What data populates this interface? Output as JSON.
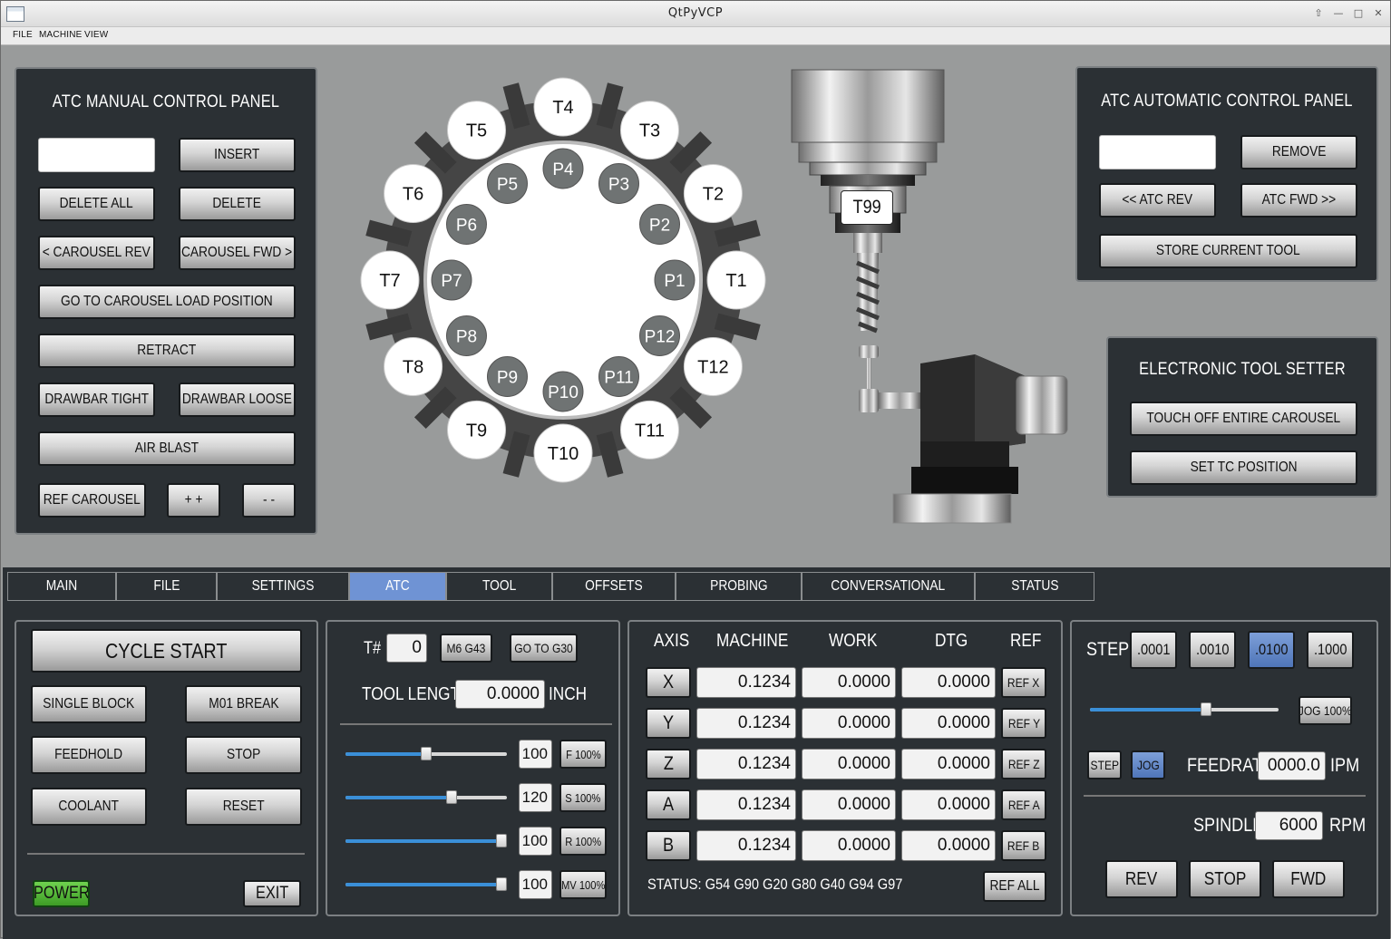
{
  "window": {
    "title": "QtPyVCP"
  },
  "menu": [
    "FILE",
    "MACHINE",
    "VIEW"
  ],
  "atc_manual": {
    "title": "ATC MANUAL CONTROL PANEL",
    "tool_input": "",
    "insert": "INSERT",
    "delete_all": "DELETE ALL",
    "delete": "DELETE",
    "carousel_rev": "< CAROUSEL REV",
    "carousel_fwd": "CAROUSEL FWD >",
    "load_position": "GO TO CAROUSEL LOAD POSITION",
    "retract": "RETRACT",
    "drawbar_tight": "DRAWBAR TIGHT",
    "drawbar_loose": "DRAWBAR LOOSE",
    "air_blast": "AIR BLAST",
    "ref_carousel": "REF CAROUSEL",
    "plus": "+ +",
    "minus": "- -"
  },
  "carousel": {
    "tools": [
      "T1",
      "T2",
      "T3",
      "T4",
      "T5",
      "T6",
      "T7",
      "T8",
      "T9",
      "T10",
      "T11",
      "T12"
    ],
    "pockets": [
      "P1",
      "P2",
      "P3",
      "P4",
      "P5",
      "P6",
      "P7",
      "P8",
      "P9",
      "P10",
      "P11",
      "P12"
    ]
  },
  "spindle_tool": "T99",
  "atc_auto": {
    "title": "ATC AUTOMATIC CONTROL PANEL",
    "tool_input": "",
    "remove": "REMOVE",
    "atc_rev": "<< ATC REV",
    "atc_fwd": "ATC FWD >>",
    "store": "STORE CURRENT TOOL"
  },
  "tool_setter": {
    "title": "ELECTRONIC TOOL SETTER",
    "touch_off": "TOUCH OFF ENTIRE CAROUSEL",
    "set_tc": "SET TC POSITION"
  },
  "tabs": [
    {
      "label": "MAIN"
    },
    {
      "label": "FILE"
    },
    {
      "label": "SETTINGS"
    },
    {
      "label": "ATC",
      "active": true
    },
    {
      "label": "TOOL"
    },
    {
      "label": "OFFSETS"
    },
    {
      "label": "PROBING"
    },
    {
      "label": "CONVERSATIONAL"
    },
    {
      "label": "STATUS"
    }
  ],
  "control": {
    "cycle_start": "CYCLE START",
    "single_block": "SINGLE BLOCK",
    "m01_break": "M01 BREAK",
    "feedhold": "FEEDHOLD",
    "stop": "STOP",
    "coolant": "COOLANT",
    "reset": "RESET",
    "power": "POWER",
    "exit": "EXIT"
  },
  "tool_panel": {
    "t_label": "T#",
    "t_value": "0",
    "m6_g43": "M6 G43",
    "go_to_g30": "GO TO G30",
    "length_label": "TOOL LENGTH",
    "length_value": "0.0000",
    "unit": "INCH",
    "overrides": [
      {
        "value": "100",
        "button": "F 100%",
        "level": 0.5
      },
      {
        "value": "120",
        "button": "S 100%",
        "level": 0.67
      },
      {
        "value": "100",
        "button": "R 100%",
        "level": 1.0
      },
      {
        "value": "100",
        "button": "MV 100%",
        "level": 1.0
      }
    ]
  },
  "dro": {
    "headers": {
      "axis": "AXIS",
      "machine": "MACHINE",
      "work": "WORK",
      "dtg": "DTG",
      "ref": "REF"
    },
    "rows": [
      {
        "axis": "X",
        "machine": "0.1234",
        "work": "0.0000",
        "dtg": "0.0000",
        "ref": "REF X"
      },
      {
        "axis": "Y",
        "machine": "0.1234",
        "work": "0.0000",
        "dtg": "0.0000",
        "ref": "REF Y"
      },
      {
        "axis": "Z",
        "machine": "0.1234",
        "work": "0.0000",
        "dtg": "0.0000",
        "ref": "REF Z"
      },
      {
        "axis": "A",
        "machine": "0.1234",
        "work": "0.0000",
        "dtg": "0.0000",
        "ref": "REF A"
      },
      {
        "axis": "B",
        "machine": "0.1234",
        "work": "0.0000",
        "dtg": "0.0000",
        "ref": "REF B"
      }
    ],
    "status": "STATUS:  G54  G90  G20  G80  G40  G94  G97",
    "ref_all": "REF ALL"
  },
  "jog": {
    "step_label": "STEP",
    "steps": [
      ".0001",
      ".0010",
      ".0100",
      ".1000"
    ],
    "active_step": 2,
    "jog_pct": "JOG 100%",
    "jog_level": 0.62,
    "mode_step": "STEP",
    "mode_jog": "JOG",
    "feedrate_label": "FEEDRATE",
    "feedrate": "0000.0",
    "feed_unit": "IPM",
    "spindle_label": "SPINDLE",
    "spindle": "6000",
    "spindle_unit": "RPM",
    "rev": "REV",
    "stop": "STOP",
    "fwd": "FWD"
  },
  "colors": {
    "panel": "#2b3034",
    "active_tab": "#6f93d4",
    "power": "#5cc63f"
  }
}
